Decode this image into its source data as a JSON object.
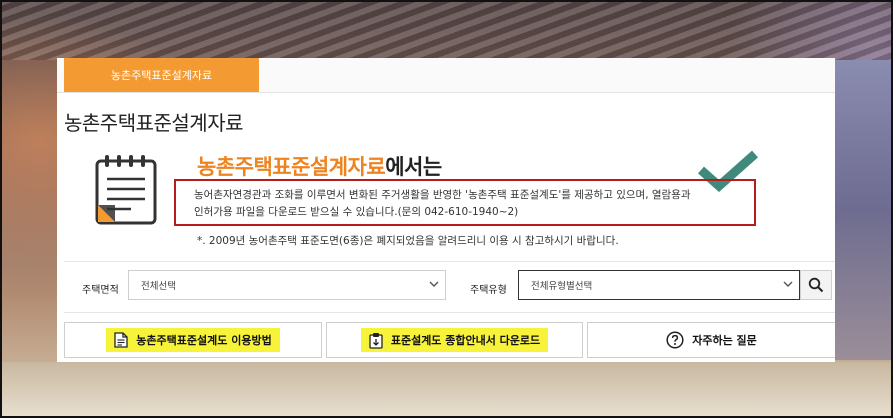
{
  "tab": {
    "label": "농촌주택표준설계자료"
  },
  "page": {
    "title": "농촌주택표준설계자료"
  },
  "intro": {
    "headline_highlight": "농촌주택표준설계자료",
    "headline_suffix": "에서는",
    "desc_line1": "농어촌자연경관과 조화를 이루면서 변화된 주거생활을 반영한 '농촌주택 표준설계도'를 제공하고 있으며, 열람용과",
    "desc_line2": "인허가용 파일을 다운로드 받으실 수 있습니다.(문의 042-610-1940~2)",
    "notice": "*. 2009년 농어촌주택 표준도면(6종)은 폐지되었음을 알려드리니 이용 시 참고하시기 바랍니다."
  },
  "filters": {
    "area_label": "주택면적",
    "area_value": "전체선택",
    "type_label": "주택유형",
    "type_value": "전체유형별선택"
  },
  "actions": {
    "usage_guide": "농촌주택표준설계도 이용방법",
    "download_guide": "표준설계도 종합안내서 다운로드",
    "faq": "자주하는 질문"
  },
  "colors": {
    "accent_orange": "#f39a33",
    "headline_orange": "#ee8420",
    "highlight_box_red": "#b51c1c",
    "button_highlight_yellow": "#f7f23a",
    "checkmark_teal": "#3f8a7a"
  },
  "icons": {
    "document": "notepad-document-icon",
    "check": "checkmark-icon",
    "search": "magnifier-icon",
    "guide": "document-icon",
    "download": "clipboard-icon",
    "faq": "question-circle-icon"
  }
}
